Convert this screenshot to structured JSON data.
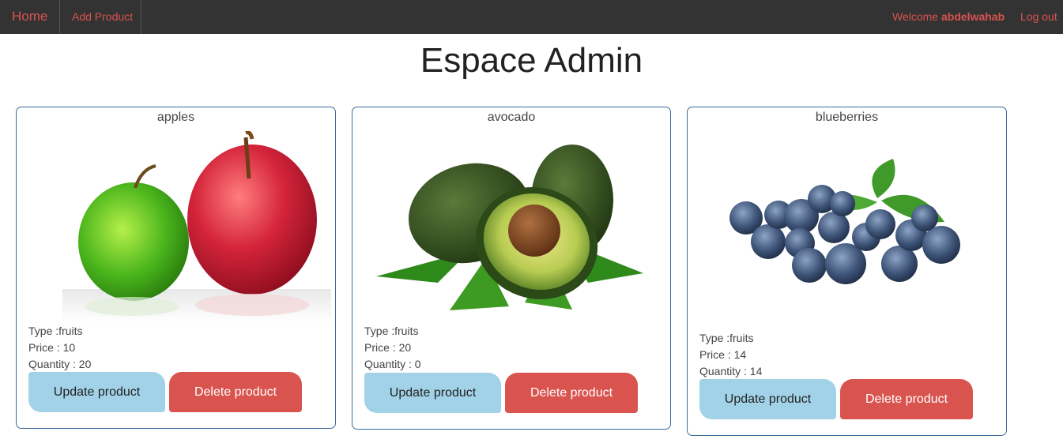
{
  "nav": {
    "home": "Home",
    "add_product": "Add Product",
    "welcome_prefix": "Welcome",
    "username": "abdelwahab",
    "logout": "Log out"
  },
  "page": {
    "title": "Espace Admin"
  },
  "products": [
    {
      "name": "apples",
      "type": "Type :fruits",
      "price": "Price : 10",
      "quantity": "Quantity : 20",
      "update_label": "Update product",
      "delete_label": "Delete product"
    },
    {
      "name": "avocado",
      "type": "Type :fruits",
      "price": "Price : 20",
      "quantity": "Quantity : 0",
      "update_label": "Update product",
      "delete_label": "Delete product"
    },
    {
      "name": "blueberries",
      "type": "Type :fruits",
      "price": "Price : 14",
      "quantity": "Quantity : 14",
      "update_label": "Update product",
      "delete_label": "Delete product"
    }
  ],
  "colors": {
    "navbar": "#333333",
    "accent": "#d9534f",
    "update_button": "#a2d2e8",
    "card_border": "#3b6a9a"
  }
}
